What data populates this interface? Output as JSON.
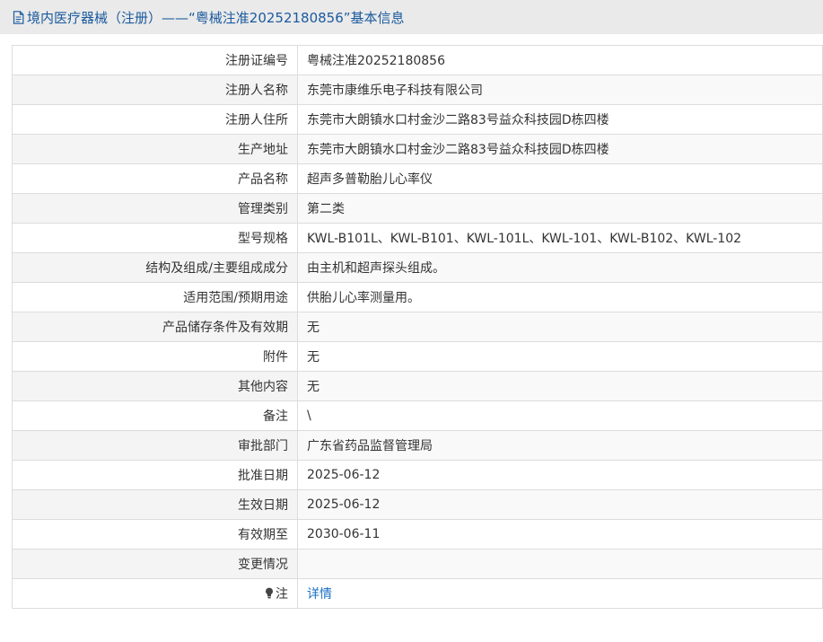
{
  "header": {
    "title": "境内医疗器械（注册）——“粤械注准20252180856”基本信息"
  },
  "rows": [
    {
      "label": "注册证编号",
      "value": "粤械注准20252180856"
    },
    {
      "label": "注册人名称",
      "value": "东莞市康维乐电子科技有限公司"
    },
    {
      "label": "注册人住所",
      "value": "东莞市大朗镇水口村金沙二路83号益众科技园D栋四楼"
    },
    {
      "label": "生产地址",
      "value": "东莞市大朗镇水口村金沙二路83号益众科技园D栋四楼"
    },
    {
      "label": "产品名称",
      "value": "超声多普勒胎儿心率仪"
    },
    {
      "label": "管理类别",
      "value": "第二类"
    },
    {
      "label": "型号规格",
      "value": "KWL-B101L、KWL-B101、KWL-101L、KWL-101、KWL-B102、KWL-102"
    },
    {
      "label": "结构及组成/主要组成成分",
      "value": "由主机和超声探头组成。"
    },
    {
      "label": "适用范围/预期用途",
      "value": "供胎儿心率测量用。"
    },
    {
      "label": "产品储存条件及有效期",
      "value": "无"
    },
    {
      "label": "附件",
      "value": "无"
    },
    {
      "label": "其他内容",
      "value": "无"
    },
    {
      "label": "备注",
      "value": "\\"
    },
    {
      "label": "审批部门",
      "value": "广东省药品监督管理局"
    },
    {
      "label": "批准日期",
      "value": "2025-06-12"
    },
    {
      "label": "生效日期",
      "value": "2025-06-12"
    },
    {
      "label": "有效期至",
      "value": "2030-06-11"
    },
    {
      "label": "变更情况",
      "value": ""
    }
  ],
  "note_row": {
    "label": "注",
    "link": "详情"
  },
  "colors": {
    "title": "#1a5a9e",
    "link": "#1a6fc1",
    "header_bg": "#eaeaea",
    "border": "#dcdcdc"
  }
}
